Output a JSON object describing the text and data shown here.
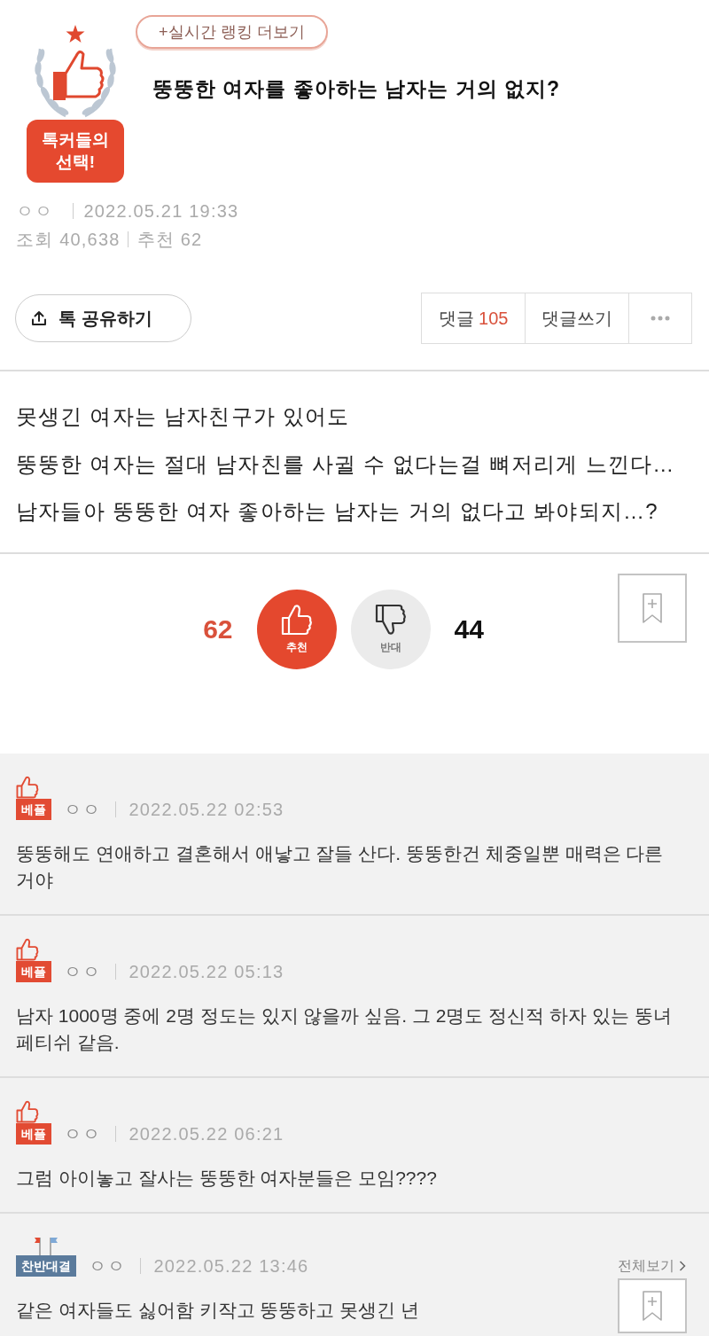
{
  "header": {
    "ranking_link": "+실시간 랭킹 더보기",
    "emblem_label": [
      "톡커들의",
      "선택!"
    ],
    "title": "뚱뚱한 여자를 좋아하는 남자는 거의 없지?"
  },
  "meta": {
    "author": "ㅇㅇ",
    "date": "2022.05.21 19:33",
    "views": "조회 40,638",
    "likes": "추천 62"
  },
  "actions": {
    "share": "톡 공유하기",
    "comments_label": "댓글",
    "comments_count": "105",
    "write": "댓글쓰기"
  },
  "body": [
    "못생긴 여자는 남자친구가 있어도",
    "뚱뚱한 여자는 절대 남자친를 사귈 수 없다는걸 뼈저리게 느낀다…",
    "남자들아 뚱뚱한 여자 좋아하는 남자는 거의 없다고 봐야되지…?"
  ],
  "votes": [
    {
      "kind": "up",
      "label": "추천",
      "count": "62"
    },
    {
      "kind": "down",
      "label": "반대",
      "count": "44"
    }
  ],
  "comments": [
    {
      "kind": "best",
      "badge": "베플",
      "author": "ㅇㅇ",
      "date": "2022.05.22 02:53",
      "text": "뚱뚱해도 연애하고 결혼해서 애낳고 잘들 산다. 뚱뚱한건 체중일뿐 매력은 다른 거야"
    },
    {
      "kind": "best",
      "badge": "베플",
      "author": "ㅇㅇ",
      "date": "2022.05.22 05:13",
      "text": "남자 1000명 중에 2명 정도는 있지 않을까 싶음. 그 2명도 정신적 하자 있는 뚱녀 페티쉬 같음."
    },
    {
      "kind": "best",
      "badge": "베플",
      "author": "ㅇㅇ",
      "date": "2022.05.22 06:21",
      "text": "그럼 아이놓고 잘사는 뚱뚱한 여자분들은 모임????"
    },
    {
      "kind": "debate",
      "badge": "찬반대결",
      "author": "ㅇㅇ",
      "date": "2022.05.22 13:46",
      "text": "같은 여자들도 싫어함 키작고 뚱뚱하고 못생긴 년",
      "more_link": "전체보기"
    }
  ]
}
